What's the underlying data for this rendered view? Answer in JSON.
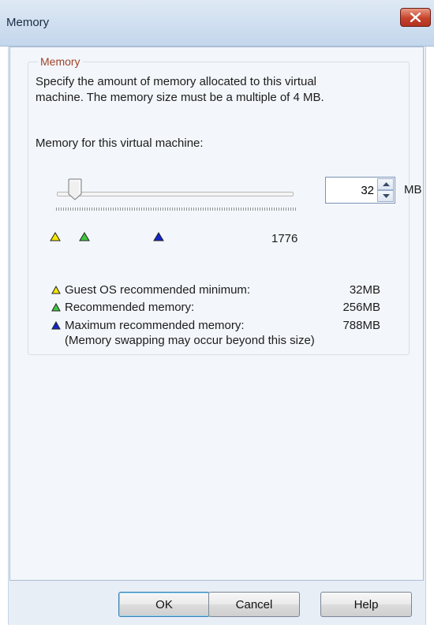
{
  "window": {
    "title": "Memory"
  },
  "group": {
    "label": "Memory",
    "description_line1": "Specify the amount of memory allocated to this virtual",
    "description_line2": "machine. The memory size must be a multiple of 4 MB.",
    "memory_label": "Memory for this virtual machine:"
  },
  "slider": {
    "value": 32,
    "max_label": "1776",
    "markers": {
      "guest_min": 32,
      "recommended": 256,
      "max_recommended": 788
    }
  },
  "spinner": {
    "value": "32",
    "unit": "MB"
  },
  "legend": [
    {
      "icon": "yellow-triangle-icon",
      "color": "#f5e600",
      "label": "Guest OS recommended minimum:",
      "value": "32MB"
    },
    {
      "icon": "green-triangle-icon",
      "color": "#3fc83f",
      "label": "Recommended memory:",
      "value": "256MB"
    },
    {
      "icon": "blue-triangle-icon",
      "color": "#1525c8",
      "label": "Maximum recommended memory:",
      "value": "788MB"
    }
  ],
  "note": "(Memory swapping may occur beyond this size)",
  "buttons": {
    "ok": "OK",
    "cancel": "Cancel",
    "help": "Help"
  }
}
